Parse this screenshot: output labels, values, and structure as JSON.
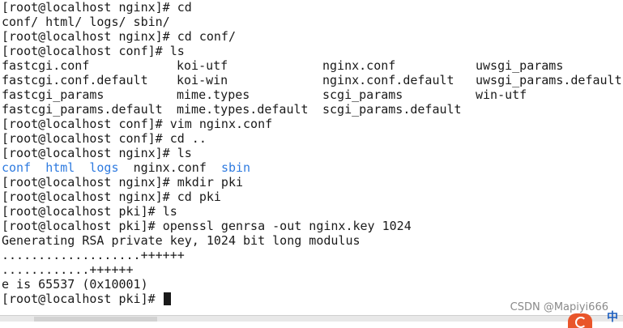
{
  "terminal": {
    "lines": [
      {
        "kind": "cmd",
        "host": "root@localhost",
        "dir": "nginx",
        "cmd": "cd"
      },
      {
        "kind": "out",
        "text": "conf/ html/ logs/ sbin/"
      },
      {
        "kind": "cmd",
        "host": "root@localhost",
        "dir": "nginx",
        "cmd": "cd conf/"
      },
      {
        "kind": "cmd",
        "host": "root@localhost",
        "dir": "conf",
        "cmd": "ls"
      },
      {
        "kind": "cols",
        "cells": [
          "fastcgi.conf",
          "koi-utf",
          "nginx.conf",
          "uwsgi_params"
        ]
      },
      {
        "kind": "cols",
        "cells": [
          "fastcgi.conf.default",
          "koi-win",
          "nginx.conf.default",
          "uwsgi_params.default"
        ]
      },
      {
        "kind": "cols",
        "cells": [
          "fastcgi_params",
          "mime.types",
          "scgi_params",
          "win-utf"
        ]
      },
      {
        "kind": "cols",
        "cells": [
          "fastcgi_params.default",
          "mime.types.default",
          "scgi_params.default",
          ""
        ]
      },
      {
        "kind": "cmd",
        "host": "root@localhost",
        "dir": "conf",
        "cmd": "vim nginx.conf"
      },
      {
        "kind": "cmd",
        "host": "root@localhost",
        "dir": "conf",
        "cmd": "cd .."
      },
      {
        "kind": "cmd",
        "host": "root@localhost",
        "dir": "nginx",
        "cmd": "ls"
      },
      {
        "kind": "ls",
        "items": [
          {
            "text": "conf",
            "dir": true
          },
          {
            "text": "html",
            "dir": true
          },
          {
            "text": "logs",
            "dir": true
          },
          {
            "text": "nginx.conf",
            "dir": false
          },
          {
            "text": "sbin",
            "dir": true
          }
        ]
      },
      {
        "kind": "cmd",
        "host": "root@localhost",
        "dir": "nginx",
        "cmd": "mkdir pki"
      },
      {
        "kind": "cmd",
        "host": "root@localhost",
        "dir": "nginx",
        "cmd": "cd pki"
      },
      {
        "kind": "cmd",
        "host": "root@localhost",
        "dir": "pki",
        "cmd": "ls"
      },
      {
        "kind": "cmd",
        "host": "root@localhost",
        "dir": "pki",
        "cmd": "openssl genrsa -out nginx.key 1024"
      },
      {
        "kind": "out",
        "text": "Generating RSA private key, 1024 bit long modulus"
      },
      {
        "kind": "out",
        "text": "...................++++++"
      },
      {
        "kind": "out",
        "text": "............++++++"
      },
      {
        "kind": "out",
        "text": "e is 65537 (0x10001)"
      },
      {
        "kind": "cmd",
        "host": "root@localhost",
        "dir": "pki",
        "cmd": "",
        "cursor": true
      }
    ]
  },
  "watermark": {
    "text": "CSDN @Mapiyi666"
  },
  "colors": {
    "directory": "#2f7be0",
    "text": "#1a1a1a",
    "background": "#ffffff"
  }
}
